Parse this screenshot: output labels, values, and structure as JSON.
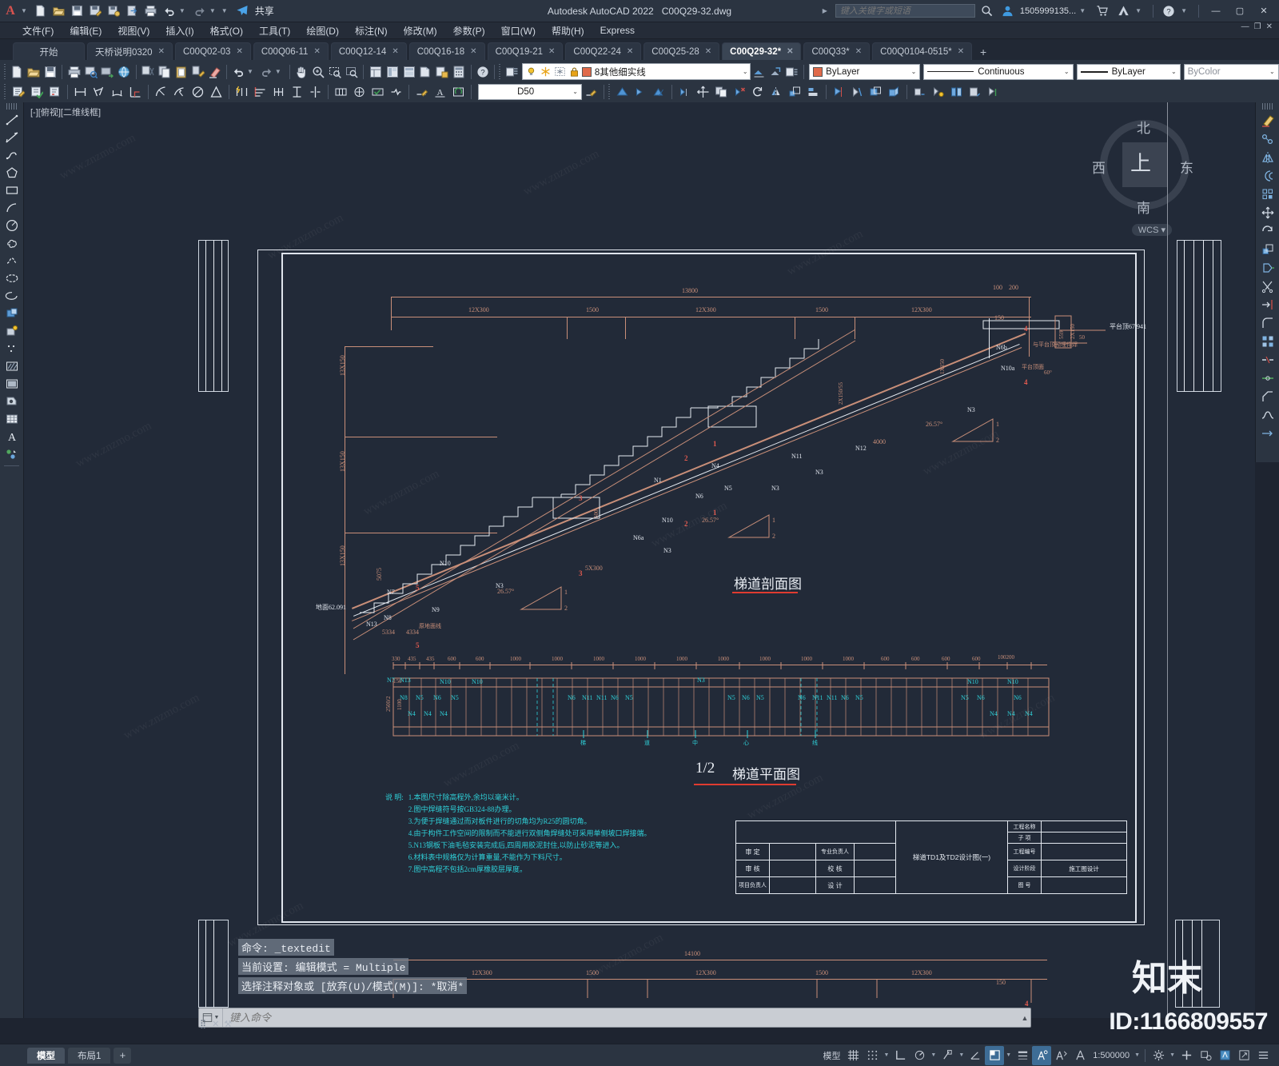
{
  "app": {
    "title": "Autodesk AutoCAD 2022",
    "document": "C00Q29-32.dwg",
    "share_label": "共享",
    "search_placeholder": "键入关键字或短语",
    "user": "1505999135...",
    "minimize": "—",
    "maximize": "▢",
    "close": "✕"
  },
  "menu": {
    "items": [
      {
        "label": "文件(F)"
      },
      {
        "label": "编辑(E)"
      },
      {
        "label": "视图(V)"
      },
      {
        "label": "插入(I)"
      },
      {
        "label": "格式(O)"
      },
      {
        "label": "工具(T)"
      },
      {
        "label": "绘图(D)"
      },
      {
        "label": "标注(N)"
      },
      {
        "label": "修改(M)"
      },
      {
        "label": "参数(P)"
      },
      {
        "label": "窗口(W)"
      },
      {
        "label": "帮助(H)"
      },
      {
        "label": "Express"
      }
    ]
  },
  "file_tabs": {
    "start_label": "开始",
    "add_label": "+",
    "close_glyph": "✕",
    "tabs": [
      {
        "label": "天桥说明0320",
        "active": false
      },
      {
        "label": "C00Q02-03",
        "active": false
      },
      {
        "label": "C00Q06-11",
        "active": false
      },
      {
        "label": "C00Q12-14",
        "active": false
      },
      {
        "label": "C00Q16-18",
        "active": false
      },
      {
        "label": "C00Q19-21",
        "active": false
      },
      {
        "label": "C00Q22-24",
        "active": false
      },
      {
        "label": "C00Q25-28",
        "active": false
      },
      {
        "label": "C00Q29-32*",
        "active": true
      },
      {
        "label": "C00Q33*",
        "active": false
      },
      {
        "label": "C00Q0104-0515*",
        "active": false
      }
    ]
  },
  "toolbar": {
    "layer_value": "8其他细实线",
    "color_value": "ByLayer",
    "linetype_value": "Continuous",
    "lineweight_value": "ByLayer",
    "plotstyle_value": "ByColor",
    "dimstyle_value": "D50",
    "caret": "⌄"
  },
  "viewport": {
    "label": "[-][俯视][二维线框]",
    "wcs_label": "WCS",
    "compass": {
      "north": "北",
      "south": "南",
      "east": "东",
      "west": "西",
      "up": "上"
    }
  },
  "drawing": {
    "section_title": "梯道剖面图",
    "plan_title_fraction": "1/2",
    "plan_title": "梯道平面图",
    "notes_label": "说 明:",
    "notes": [
      "1.本图尺寸除高程外,余均以毫米计。",
      "2.图中焊缝符号按GB324-88办理。",
      "3.为便于焊缝通过而对板件进行的切角均为R25的圆切角。",
      "4.由于构件工作空间的限制而不能进行双侧角焊缝处可采用单侧坡口焊接端。",
      "5.N13钢板下油毛毡安装完成后,四周用胶泥封住,以防止砂泥等进入。",
      "6.材料表中规格仅为计算重量,不能作为下料尺寸。",
      "7.图中高程不包括2cm厚橡胶层厚度。"
    ],
    "titleblock": {
      "project_name_label": "工程名称",
      "subitem_label": "子 项",
      "approve_label": "审 定",
      "review_label": "审 核",
      "manager_label": "项目负责人",
      "specialist_label": "专业负责人",
      "check_label": "校 核",
      "design_label": "设 计",
      "sheet_title": "梯道TD1及TD2设计图(一)",
      "project_no_label": "工程编号",
      "stage_label": "设计阶段",
      "stage_value": "施工图设计",
      "drawing_no_label": "图 号"
    },
    "top_dims": {
      "total": "13800",
      "segments": [
        "12X300",
        "1500",
        "12X300",
        "1500",
        "12X300"
      ],
      "right_notes": [
        "100",
        "200",
        "150"
      ]
    },
    "left_dims": [
      "13X150",
      "13X150",
      "13X150"
    ],
    "elevations": {
      "top": "平台顶67.941",
      "bottom": "地面62.091"
    },
    "slope_labels": [
      "26.57°",
      "1",
      "2"
    ],
    "rebar_marks": [
      "N6b",
      "N10a",
      "N3",
      "N11",
      "N12",
      "N1",
      "N4",
      "N5",
      "N6",
      "N10",
      "N9",
      "N7",
      "N13",
      "N8",
      "N6a"
    ],
    "plan_dims": [
      "330",
      "435",
      "435",
      "600",
      "600",
      "1000",
      "1000",
      "1000",
      "1000",
      "1000",
      "1000",
      "1000",
      "1000",
      "1000",
      "600",
      "600",
      "600",
      "600"
    ],
    "plan_left_dims": [
      "2500/2",
      "1100",
      "150"
    ],
    "plan_marks": [
      "N4",
      "N5",
      "N6",
      "N8",
      "N10",
      "N11",
      "N13",
      "N1",
      "N3"
    ],
    "bubbles": [
      "1",
      "2",
      "3",
      "4",
      "5"
    ],
    "extra_dims": [
      "5X300",
      "5X300",
      "50",
      "500",
      "2X150",
      "559",
      "4000",
      "100200",
      "14100"
    ]
  },
  "command": {
    "history": [
      "命令: _textedit",
      "当前设置: 编辑模式 = Multiple",
      "选择注释对象或 [放弃(U)/模式(M)]: *取消*"
    ],
    "prompt_placeholder": "键入命令",
    "close_glyph": "✕",
    "tool_glyph": "⚒"
  },
  "status": {
    "model_tab": "模型",
    "layout_tab": "布局1",
    "add_layout": "+",
    "model_button": "模型",
    "scale": "1:500000",
    "items": [
      {
        "name": "grid-display",
        "glyph": "▦",
        "on": false
      },
      {
        "name": "snap-mode",
        "glyph": "⋮⋮",
        "on": false
      },
      {
        "name": "ortho-mode",
        "glyph": "⌐",
        "on": false
      },
      {
        "name": "polar-tracking",
        "glyph": "◷",
        "on": false
      },
      {
        "name": "object-snap",
        "glyph": "⌁",
        "on": false
      },
      {
        "name": "osnap-tracking",
        "glyph": "∠",
        "on": false
      },
      {
        "name": "ucs-icon",
        "glyph": "◱",
        "on": true
      },
      {
        "name": "lineweight",
        "glyph": "≡",
        "on": false
      },
      {
        "name": "annotation-visibility",
        "glyph": "人",
        "on": true
      },
      {
        "name": "autoscale",
        "glyph": "人",
        "on": false
      },
      {
        "name": "annotation-scale",
        "glyph": "人",
        "on": false
      }
    ]
  },
  "watermark": {
    "site": "www.znzmo.com",
    "brand": "知末",
    "id": "ID:1166809557"
  }
}
